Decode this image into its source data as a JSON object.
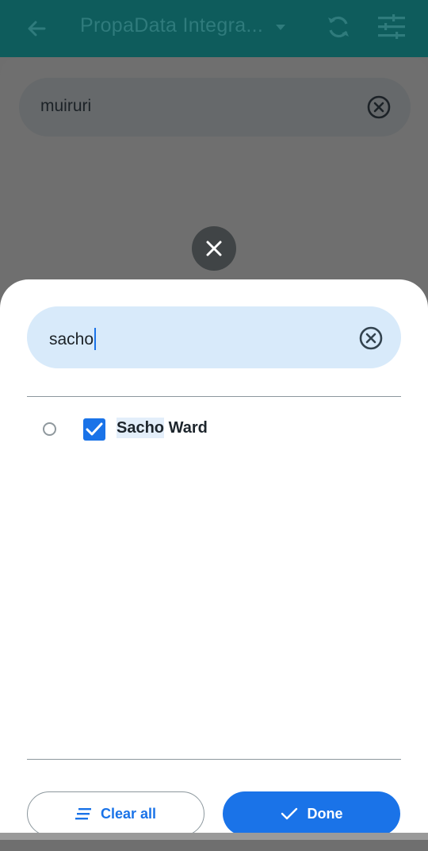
{
  "app_bar": {
    "title": "PropaData Integra...",
    "icons": [
      "arrow-back-icon",
      "dropdown-arrow-icon",
      "sync-icon",
      "tune-icon"
    ]
  },
  "background_search": {
    "value": "muiruri",
    "clear_icon": "cancel-icon"
  },
  "overlay": {
    "close_icon": "close-icon"
  },
  "sheet": {
    "search": {
      "value": "sacho",
      "clear_icon": "cancel-icon"
    },
    "results": [
      {
        "match": "Sacho",
        "rest": " Ward",
        "checked": true,
        "radio_selected": false
      }
    ],
    "actions": {
      "clear_label": "Clear all",
      "done_label": "Done"
    }
  },
  "colors": {
    "app_bar": "#0e5c5c",
    "accent": "#1a73e8",
    "search_bg": "#d8eafa"
  }
}
